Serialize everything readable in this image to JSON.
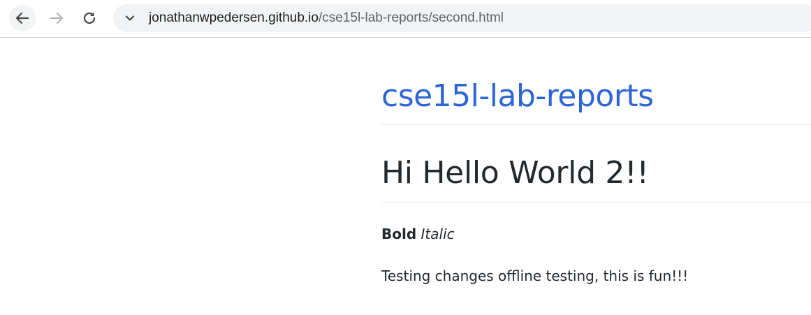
{
  "browser": {
    "back_icon": "arrow-left-icon",
    "forward_icon": "arrow-right-icon",
    "reload_icon": "reload-icon",
    "site_info_icon": "chevron-down-icon",
    "url_domain": "jonathanwpedersen.github.io",
    "url_path": "/cse15l-lab-reports/second.html"
  },
  "page": {
    "site_title": "cse15l-lab-reports",
    "heading": "Hi Hello World 2!!",
    "bold_text": "Bold",
    "italic_text": "Italic",
    "paragraph": "Testing changes offline testing, this is fun!!!"
  },
  "colors": {
    "link": "#2c66d6",
    "text": "#24292e",
    "toolbar_bg": "#f1f3f4"
  }
}
